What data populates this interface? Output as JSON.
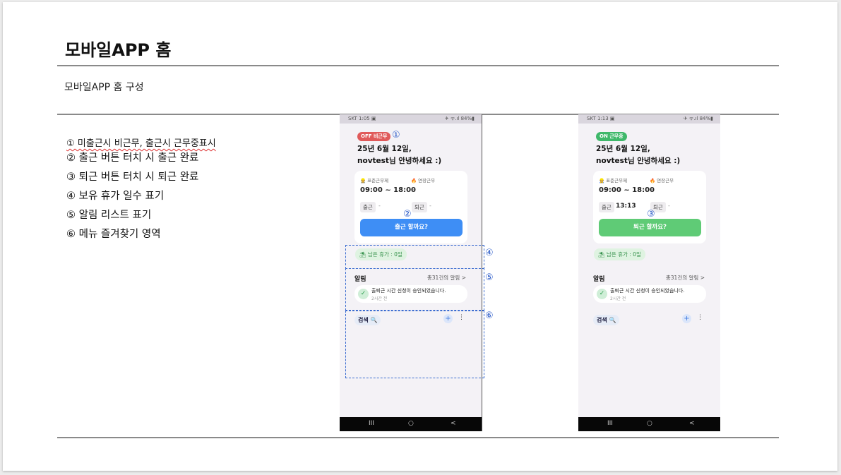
{
  "slide": {
    "title": "모바일APP 홈",
    "subtitle": "모바일APP 홈 구성",
    "descriptions": [
      "① 미출근시 비근무, 출근시 근무중표시",
      "② 출근 버튼 터치 시 출근 완료",
      "③ 퇴근 버튼 터치 시 퇴근 완료",
      "④ 보유 휴가 일수 표기",
      "⑤ 알림 리스트 표기",
      "⑥ 메뉴 즐겨찾기 영역"
    ]
  },
  "phone_before": {
    "status_left": "SKT 1:05 ▣",
    "status_right": "✈ ᯤ.ıl 84%▮",
    "badge": "OFF 비근무",
    "greeting_line1": "25년 6월 12일,",
    "greeting_line2": "novtest님 안녕하세요 :)",
    "standard_label": "표준근무제",
    "overtime_label": "연장근무",
    "work_time": "09:00 ~ 18:00",
    "overtime_value": "-",
    "checkin_label": "출근",
    "checkin_value": "-",
    "checkout_label": "퇴근",
    "checkout_value": "-",
    "button": "출근 할까요?",
    "leave": "남은 휴가 : 0일",
    "notif_title": "알림",
    "notif_count": "총31건의 알림 >",
    "notif_message": "출퇴근 시간 신청이 승인되었습니다.",
    "notif_time": "2시간 전",
    "search": "검색 🔍",
    "plus": "+",
    "more": "⋮"
  },
  "phone_after": {
    "status_left": "SKT 1:13 ▣",
    "status_right": "✈ ᯤ.ıl 84%▮",
    "badge": "ON 근무중",
    "greeting_line1": "25년 6월 12일,",
    "greeting_line2": "novtest님 안녕하세요 :)",
    "standard_label": "표준근무제",
    "overtime_label": "연장근무",
    "work_time": "09:00 ~ 18:00",
    "overtime_value": "-",
    "checkin_label": "출근",
    "checkin_value": "13:13",
    "checkout_label": "퇴근",
    "checkout_value": "-",
    "button": "퇴근 할까요?",
    "leave": "남은 휴가 : 0일",
    "notif_title": "알림",
    "notif_count": "총31건의 알림 >",
    "notif_message": "출퇴근 시간 신청이 승인되었습니다.",
    "notif_time": "2시간 전",
    "search": "검색 🔍",
    "plus": "+",
    "more": "⋮"
  },
  "navbar": {
    "recent": "III",
    "home": "○",
    "back": "<"
  },
  "annotations": [
    "①",
    "②",
    "③",
    "④",
    "⑤",
    "⑥"
  ]
}
